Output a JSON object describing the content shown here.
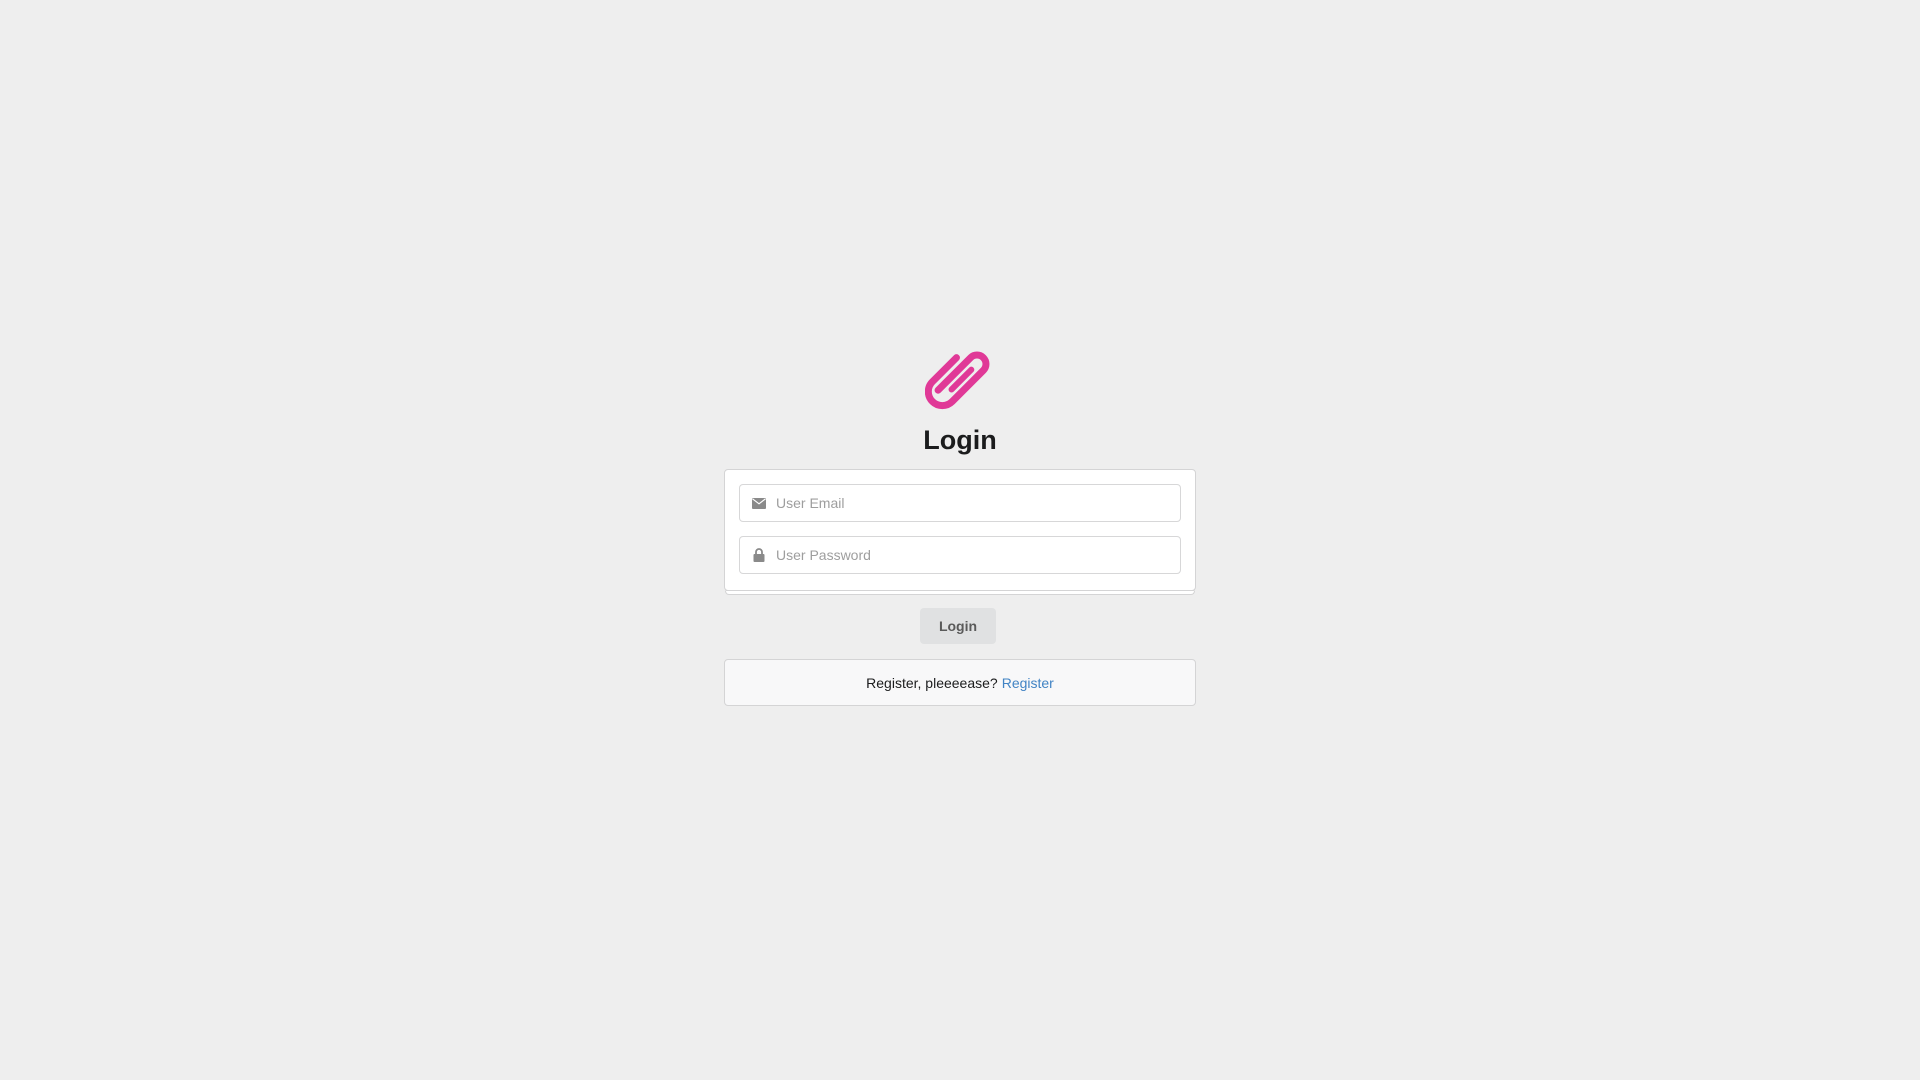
{
  "header": {
    "logo_icon": "paperclip-icon",
    "title": "Login"
  },
  "form": {
    "email": {
      "icon": "envelope-icon",
      "placeholder": "User Email",
      "value": ""
    },
    "password": {
      "icon": "lock-icon",
      "placeholder": "User Password",
      "value": ""
    },
    "submit_label": "Login"
  },
  "register": {
    "prompt": "Register, pleeeease?",
    "link_label": "Register"
  },
  "colors": {
    "background": "#eeeeee",
    "accent": "#e03997",
    "link": "#4183c4",
    "button_bg": "#e0e1e2"
  }
}
